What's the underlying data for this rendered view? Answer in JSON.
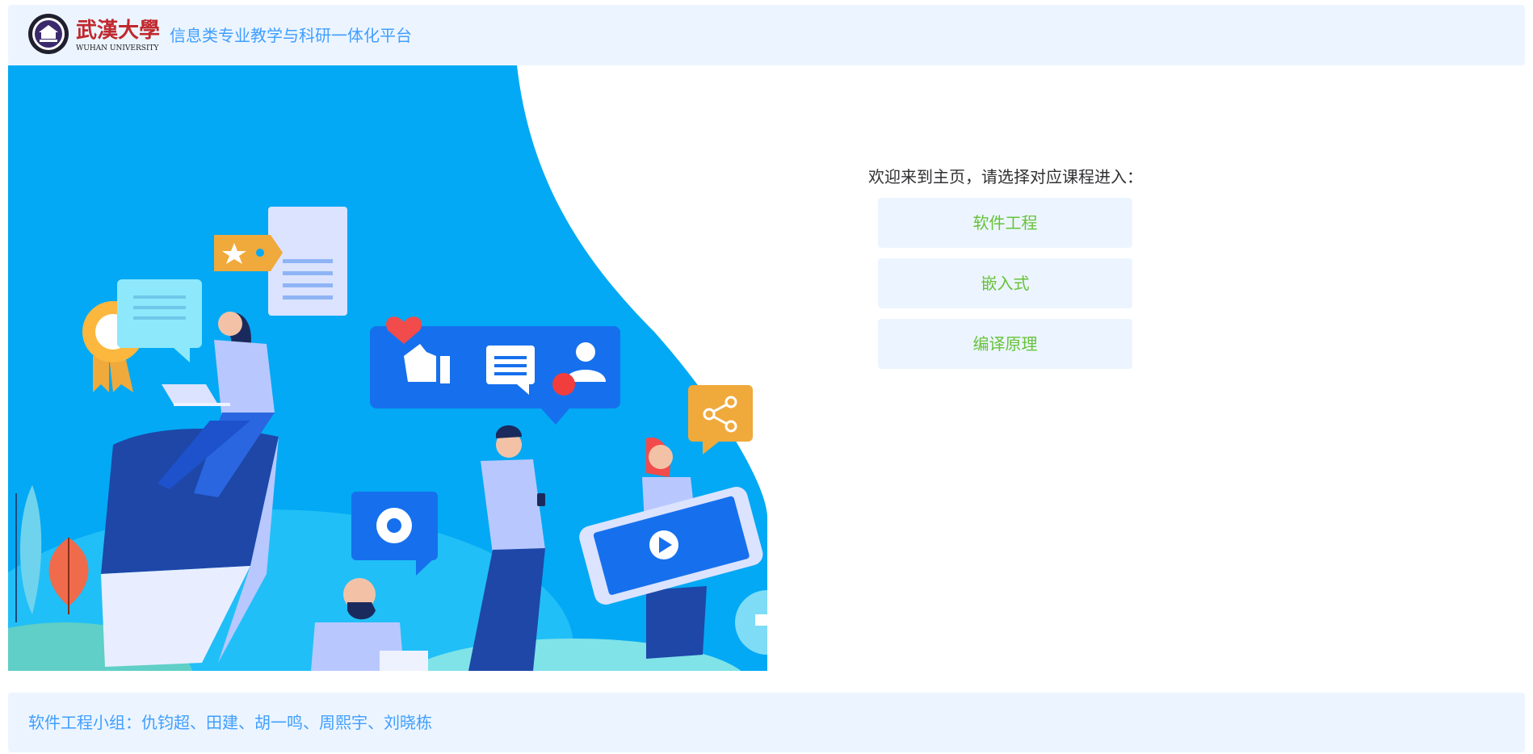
{
  "header": {
    "logo_chinese": "武漢大學",
    "logo_english": "WUHAN UNIVERSITY",
    "platform_title": "信息类专业教学与科研一体化平台"
  },
  "main": {
    "welcome_text": "欢迎来到主页，请选择对应课程进入：",
    "courses": [
      {
        "label": "软件工程"
      },
      {
        "label": "嵌入式"
      },
      {
        "label": "编译原理"
      }
    ]
  },
  "footer": {
    "team_text": "软件工程小组：仇钧超、田建、胡一鸣、周熙宇、刘晓栋"
  },
  "colors": {
    "header_bg": "#ecf5ff",
    "accent_blue": "#409eff",
    "course_green": "#67c23a",
    "hero_blue": "#03a9f4"
  },
  "icons": [
    "university-seal-icon",
    "star-tag-icon",
    "document-icon",
    "chat-icon",
    "badge-icon",
    "like-icon",
    "message-icon",
    "user-icon",
    "heart-icon",
    "share-icon",
    "gear-icon",
    "play-icon",
    "cart-icon"
  ]
}
